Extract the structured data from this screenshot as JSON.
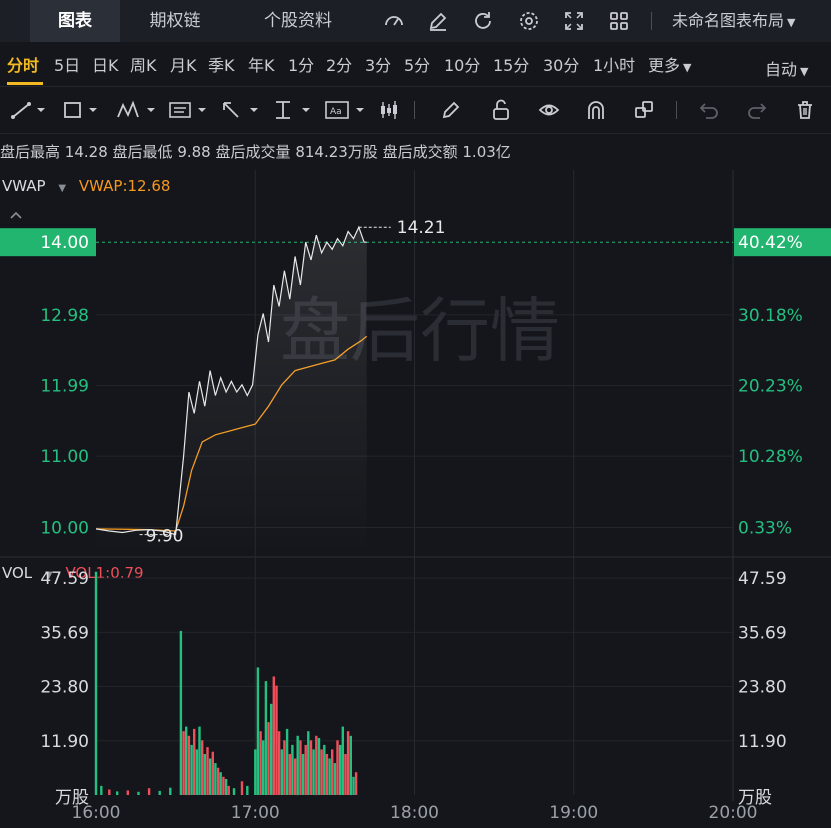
{
  "tabs": [
    {
      "label": "图表",
      "active": true
    },
    {
      "label": "期权链",
      "active": false
    },
    {
      "label": "个股资料",
      "active": false
    }
  ],
  "toolbar_icons": [
    "gauge-icon",
    "pencil-icon",
    "refresh-icon",
    "settings-icon",
    "fullscreen-icon",
    "grid-icon"
  ],
  "layout_label": "未命名图表布局",
  "periods": [
    "分时",
    "5日",
    "日K",
    "周K",
    "月K",
    "季K",
    "年K",
    "1分",
    "2分",
    "3分",
    "5分",
    "10分",
    "15分",
    "30分",
    "1小时",
    "更多"
  ],
  "active_period": "分时",
  "auto_label": "自动",
  "drawing_tools": [
    "trend-line-icon",
    "rectangle-icon",
    "wave-icon",
    "text-icon",
    "arrow-icon",
    "measure-icon",
    "annotation-icon",
    "candle-icon",
    "brush-icon",
    "unlock-icon",
    "eye-icon",
    "magnet-icon",
    "layers-icon",
    "undo-icon",
    "redo-icon",
    "trash-icon"
  ],
  "info": {
    "high_label": "盘后最高",
    "high": "14.28",
    "low_label": "盘后最低",
    "low": "9.88",
    "vol_label": "盘后成交量",
    "vol": "814.23万股",
    "amt_label": "盘后成交额",
    "amt": "1.03亿"
  },
  "indicators": {
    "main_name": "VWAP",
    "main_value": "VWAP:12.68",
    "sub_name": "VOL",
    "sub_value": "VOL1:0.79"
  },
  "watermark": "盘后行情",
  "colors": {
    "up": "#ef4f5a",
    "down": "#24c080",
    "vwap": "#f59a1e",
    "price": "#e8e8e8",
    "accent": "#f3b922",
    "current_price_bg": "#21b56f"
  },
  "chart_data": {
    "type": "line",
    "x_ticks": [
      "16:00",
      "17:00",
      "18:00",
      "19:00",
      "20:00"
    ],
    "price_axis_left": [
      "10.00",
      "11.00",
      "11.99",
      "12.98",
      "14.00"
    ],
    "price_axis_right": [
      "0.33%",
      "10.28%",
      "20.23%",
      "30.18%",
      "40.42%"
    ],
    "current_price": "14.00",
    "current_pct": "40.42%",
    "marker_high": "14.21",
    "marker_low": "9.90",
    "ylim": [
      9.6,
      14.9
    ],
    "price_series": {
      "name": "",
      "x": [
        "16:00",
        "16:05",
        "16:10",
        "16:15",
        "16:20",
        "16:25",
        "16:30",
        "16:33",
        "16:35",
        "16:37",
        "16:39",
        "16:41",
        "16:43",
        "16:45",
        "16:47",
        "16:49",
        "16:51",
        "16:53",
        "16:55",
        "16:57",
        "16:59",
        "17:01",
        "17:03",
        "17:05",
        "17:07",
        "17:09",
        "17:11",
        "17:13",
        "17:15",
        "17:17",
        "17:19",
        "17:21",
        "17:23",
        "17:25",
        "17:27",
        "17:29",
        "17:31",
        "17:33",
        "17:35",
        "17:37",
        "17:39",
        "17:41",
        "17:42"
      ],
      "values": [
        9.98,
        9.95,
        9.93,
        9.96,
        9.97,
        9.95,
        9.9,
        11.0,
        11.9,
        11.6,
        12.05,
        11.7,
        12.2,
        11.85,
        12.1,
        11.9,
        12.05,
        11.9,
        12.0,
        11.85,
        12.0,
        12.7,
        13.0,
        12.6,
        13.4,
        13.1,
        13.6,
        13.2,
        13.8,
        13.4,
        14.0,
        13.75,
        14.1,
        13.85,
        14.0,
        13.9,
        14.05,
        13.95,
        14.15,
        14.05,
        14.21,
        14.0,
        14.0
      ]
    },
    "vwap_series": {
      "name": "VWAP",
      "x": [
        "16:00",
        "16:20",
        "16:30",
        "16:33",
        "16:36",
        "16:40",
        "16:45",
        "16:50",
        "16:55",
        "17:00",
        "17:05",
        "17:10",
        "17:15",
        "17:20",
        "17:25",
        "17:30",
        "17:35",
        "17:40",
        "17:42"
      ],
      "values": [
        9.98,
        9.97,
        9.95,
        10.3,
        10.8,
        11.2,
        11.3,
        11.35,
        11.4,
        11.45,
        11.7,
        12.0,
        12.2,
        12.25,
        12.3,
        12.35,
        12.5,
        12.62,
        12.68
      ]
    },
    "volume": {
      "ylabel": "万股",
      "y_ticks": [
        "11.90",
        "23.80",
        "35.69",
        "47.59"
      ],
      "ylim": [
        0,
        52
      ],
      "bars": [
        {
          "t": "16:00",
          "v": 49.0,
          "d": "down"
        },
        {
          "t": "16:02",
          "v": 2.0,
          "d": "down"
        },
        {
          "t": "16:05",
          "v": 1.2,
          "d": "up"
        },
        {
          "t": "16:08",
          "v": 0.8,
          "d": "down"
        },
        {
          "t": "16:12",
          "v": 1.0,
          "d": "up"
        },
        {
          "t": "16:16",
          "v": 0.7,
          "d": "down"
        },
        {
          "t": "16:20",
          "v": 1.5,
          "d": "up"
        },
        {
          "t": "16:24",
          "v": 0.9,
          "d": "down"
        },
        {
          "t": "16:28",
          "v": 1.6,
          "d": "down"
        },
        {
          "t": "16:32",
          "v": 36.0,
          "d": "down"
        },
        {
          "t": "16:33",
          "v": 14.0,
          "d": "up"
        },
        {
          "t": "16:34",
          "v": 15.0,
          "d": "down"
        },
        {
          "t": "16:35",
          "v": 13.0,
          "d": "up"
        },
        {
          "t": "16:36",
          "v": 11.0,
          "d": "down"
        },
        {
          "t": "16:37",
          "v": 14.5,
          "d": "up"
        },
        {
          "t": "16:38",
          "v": 10.0,
          "d": "down"
        },
        {
          "t": "16:39",
          "v": 15.0,
          "d": "down"
        },
        {
          "t": "16:40",
          "v": 12.0,
          "d": "up"
        },
        {
          "t": "16:41",
          "v": 9.0,
          "d": "down"
        },
        {
          "t": "16:42",
          "v": 10.5,
          "d": "up"
        },
        {
          "t": "16:43",
          "v": 8.0,
          "d": "down"
        },
        {
          "t": "16:44",
          "v": 9.5,
          "d": "up"
        },
        {
          "t": "16:45",
          "v": 7.0,
          "d": "down"
        },
        {
          "t": "16:46",
          "v": 6.0,
          "d": "up"
        },
        {
          "t": "16:47",
          "v": 5.0,
          "d": "down"
        },
        {
          "t": "16:48",
          "v": 4.0,
          "d": "up"
        },
        {
          "t": "16:49",
          "v": 3.5,
          "d": "down"
        },
        {
          "t": "16:50",
          "v": 2.0,
          "d": "up"
        },
        {
          "t": "16:52",
          "v": 1.5,
          "d": "down"
        },
        {
          "t": "16:55",
          "v": 3.0,
          "d": "up"
        },
        {
          "t": "16:57",
          "v": 2.0,
          "d": "down"
        },
        {
          "t": "17:00",
          "v": 10.0,
          "d": "down"
        },
        {
          "t": "17:01",
          "v": 28.0,
          "d": "down"
        },
        {
          "t": "17:02",
          "v": 14.0,
          "d": "up"
        },
        {
          "t": "17:03",
          "v": 12.0,
          "d": "down"
        },
        {
          "t": "17:04",
          "v": 25.0,
          "d": "down"
        },
        {
          "t": "17:05",
          "v": 16.0,
          "d": "up"
        },
        {
          "t": "17:06",
          "v": 20.0,
          "d": "down"
        },
        {
          "t": "17:07",
          "v": 26.0,
          "d": "up"
        },
        {
          "t": "17:08",
          "v": 24.0,
          "d": "up"
        },
        {
          "t": "17:09",
          "v": 14.0,
          "d": "up"
        },
        {
          "t": "17:10",
          "v": 10.0,
          "d": "down"
        },
        {
          "t": "17:11",
          "v": 12.0,
          "d": "up"
        },
        {
          "t": "17:12",
          "v": 14.5,
          "d": "down"
        },
        {
          "t": "17:13",
          "v": 9.0,
          "d": "up"
        },
        {
          "t": "17:14",
          "v": 11.0,
          "d": "down"
        },
        {
          "t": "17:15",
          "v": 8.0,
          "d": "up"
        },
        {
          "t": "17:16",
          "v": 13.0,
          "d": "down"
        },
        {
          "t": "17:17",
          "v": 12.0,
          "d": "up"
        },
        {
          "t": "17:18",
          "v": 9.0,
          "d": "down"
        },
        {
          "t": "17:19",
          "v": 11.0,
          "d": "up"
        },
        {
          "t": "17:20",
          "v": 14.0,
          "d": "down"
        },
        {
          "t": "17:21",
          "v": 12.0,
          "d": "up"
        },
        {
          "t": "17:22",
          "v": 10.0,
          "d": "down"
        },
        {
          "t": "17:23",
          "v": 13.0,
          "d": "up"
        },
        {
          "t": "17:24",
          "v": 12.5,
          "d": "down"
        },
        {
          "t": "17:25",
          "v": 10.0,
          "d": "up"
        },
        {
          "t": "17:26",
          "v": 11.0,
          "d": "down"
        },
        {
          "t": "17:27",
          "v": 9.0,
          "d": "up"
        },
        {
          "t": "17:28",
          "v": 8.0,
          "d": "down"
        },
        {
          "t": "17:29",
          "v": 10.0,
          "d": "up"
        },
        {
          "t": "17:30",
          "v": 7.0,
          "d": "down"
        },
        {
          "t": "17:31",
          "v": 12.0,
          "d": "up"
        },
        {
          "t": "17:32",
          "v": 11.0,
          "d": "down"
        },
        {
          "t": "17:33",
          "v": 15.0,
          "d": "down"
        },
        {
          "t": "17:34",
          "v": 9.0,
          "d": "up"
        },
        {
          "t": "17:35",
          "v": 14.0,
          "d": "up"
        },
        {
          "t": "17:36",
          "v": 13.0,
          "d": "down"
        },
        {
          "t": "17:37",
          "v": 4.0,
          "d": "down"
        },
        {
          "t": "17:38",
          "v": 5.0,
          "d": "up"
        }
      ]
    }
  }
}
